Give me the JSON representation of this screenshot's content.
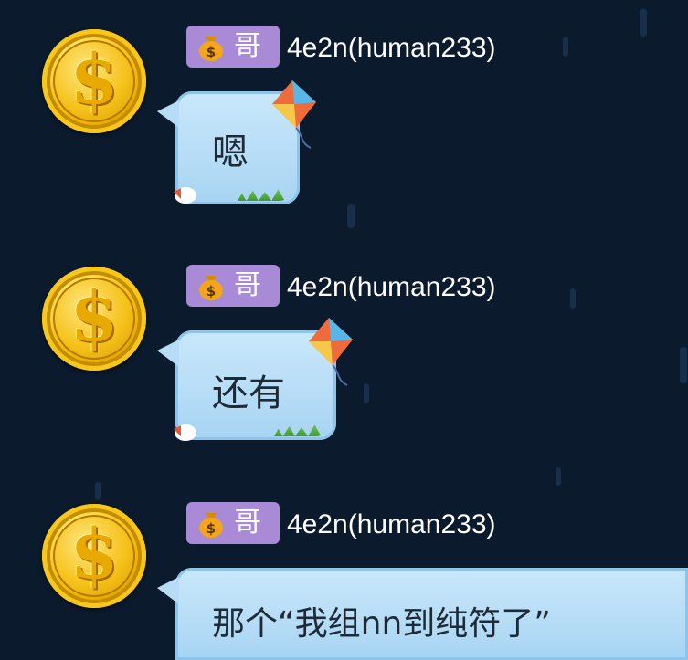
{
  "messages": [
    {
      "badge": "哥",
      "username": "4e2n(human233)",
      "text": "嗯"
    },
    {
      "badge": "哥",
      "username": "4e2n(human233)",
      "text": "还有"
    },
    {
      "badge": "哥",
      "username": "4e2n(human233)",
      "text": "那个“我组nn到纯符了”"
    }
  ],
  "icons": {
    "avatar": "gold-dollar-coin-icon",
    "badge": "money-bag-icon",
    "bubble_decoration": "kite-icon"
  },
  "colors": {
    "background": "#0b1a2c",
    "badge": "#a98ad6",
    "bubble": "#b6dcf6",
    "username": "#ffffff"
  }
}
